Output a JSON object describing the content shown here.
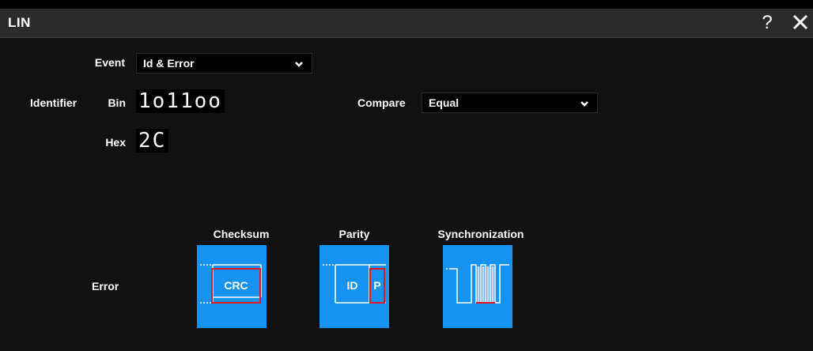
{
  "window": {
    "title": "LIN"
  },
  "toolbar": {
    "help_glyph": "?",
    "close_icon": "close-icon"
  },
  "event": {
    "label": "Event",
    "value": "Id & Error"
  },
  "identifier": {
    "label": "Identifier",
    "bin_label": "Bin",
    "bin_value": "1o11oo",
    "hex_label": "Hex",
    "hex_value": "2C"
  },
  "compare": {
    "label": "Compare",
    "value": "Equal"
  },
  "error": {
    "label": "Error",
    "buttons": [
      {
        "label": "Checksum",
        "icon_text": "CRC",
        "icon": "checksum-icon"
      },
      {
        "label": "Parity",
        "icon_text_id": "ID",
        "icon_text_p": "P",
        "icon": "parity-icon"
      },
      {
        "label": "Synchronization",
        "icon": "synchronization-icon"
      }
    ]
  },
  "colors": {
    "accent": "#1692f0",
    "highlight": "#e8131b",
    "titlebar": "#2b2b2b"
  }
}
